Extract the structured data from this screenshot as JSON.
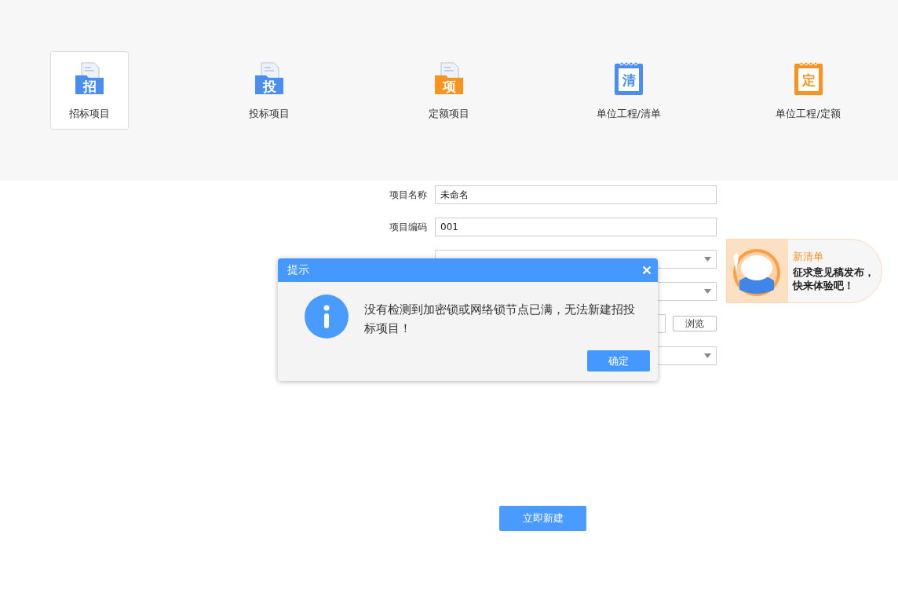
{
  "project_types": [
    {
      "label": "招标项目",
      "kind": "folder",
      "glyph": "招",
      "color": "#4a8ff0",
      "selected": true
    },
    {
      "label": "投标项目",
      "kind": "folder",
      "glyph": "投",
      "color": "#4a8ff0",
      "selected": false
    },
    {
      "label": "定额项目",
      "kind": "folder",
      "glyph": "项",
      "color": "#f7931e",
      "selected": false
    },
    {
      "label": "单位工程/清单",
      "kind": "notebook",
      "glyph": "清",
      "color": "#4a8ff0",
      "selected": false
    },
    {
      "label": "单位工程/定额",
      "kind": "notebook",
      "glyph": "定",
      "color": "#f7931e",
      "selected": false
    }
  ],
  "form": {
    "fields": [
      {
        "kind": "input",
        "label": "项目名称",
        "value": "未命名"
      },
      {
        "kind": "input",
        "label": "项目编码",
        "value": "001"
      },
      {
        "kind": "select"
      },
      {
        "kind": "select"
      },
      {
        "kind": "file",
        "button": "浏览"
      },
      {
        "kind": "select"
      }
    ]
  },
  "create_button": "立即新建",
  "dialog": {
    "title": "提示",
    "message": "没有检测到加密锁或网络锁节点已满，无法新建招投标项目！",
    "ok_button": "确定"
  },
  "promo": {
    "title": "新清单",
    "text": "征求意见稿发布，快来体验吧！"
  }
}
